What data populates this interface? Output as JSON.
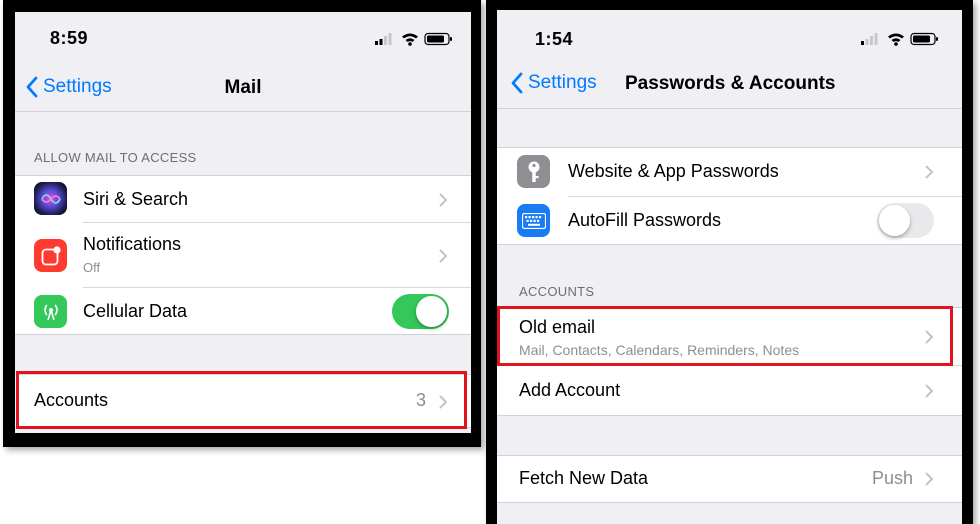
{
  "left_screen": {
    "status_time": "8:59",
    "nav": {
      "back_label": "Settings",
      "title": "Mail"
    },
    "section_header": "ALLOW MAIL TO ACCESS",
    "rows": [
      {
        "label": "Siri & Search",
        "icon": "siri-icon"
      },
      {
        "label": "Notifications",
        "sublabel": "Off",
        "icon": "notifications-icon"
      },
      {
        "label": "Cellular Data",
        "icon": "cellular-icon",
        "toggle_on": true
      }
    ],
    "accounts_row": {
      "label": "Accounts",
      "value": "3"
    }
  },
  "right_screen": {
    "status_time": "1:54",
    "nav": {
      "back_label": "Settings",
      "title": "Passwords & Accounts"
    },
    "rows": [
      {
        "label": "Website & App Passwords",
        "icon": "key-icon"
      },
      {
        "label": "AutoFill Passwords",
        "icon": "keyboard-icon",
        "toggle_on": false
      }
    ],
    "accounts_section_header": "ACCOUNTS",
    "accounts": [
      {
        "label": "Old email",
        "sublabel": "Mail, Contacts, Calendars, Reminders, Notes"
      }
    ],
    "add_account_label": "Add Account",
    "fetch_row": {
      "label": "Fetch New Data",
      "value": "Push"
    }
  },
  "colors": {
    "ios_blue": "#007aff",
    "toggle_on_green": "#34c759",
    "highlight_red": "#e0141e",
    "siri_gradient": "#2b2b8a",
    "notifications_red": "#ff3b30",
    "cellular_green": "#34c759",
    "key_gray": "#8e8e93",
    "keyboard_blue": "#1a7cf5"
  }
}
